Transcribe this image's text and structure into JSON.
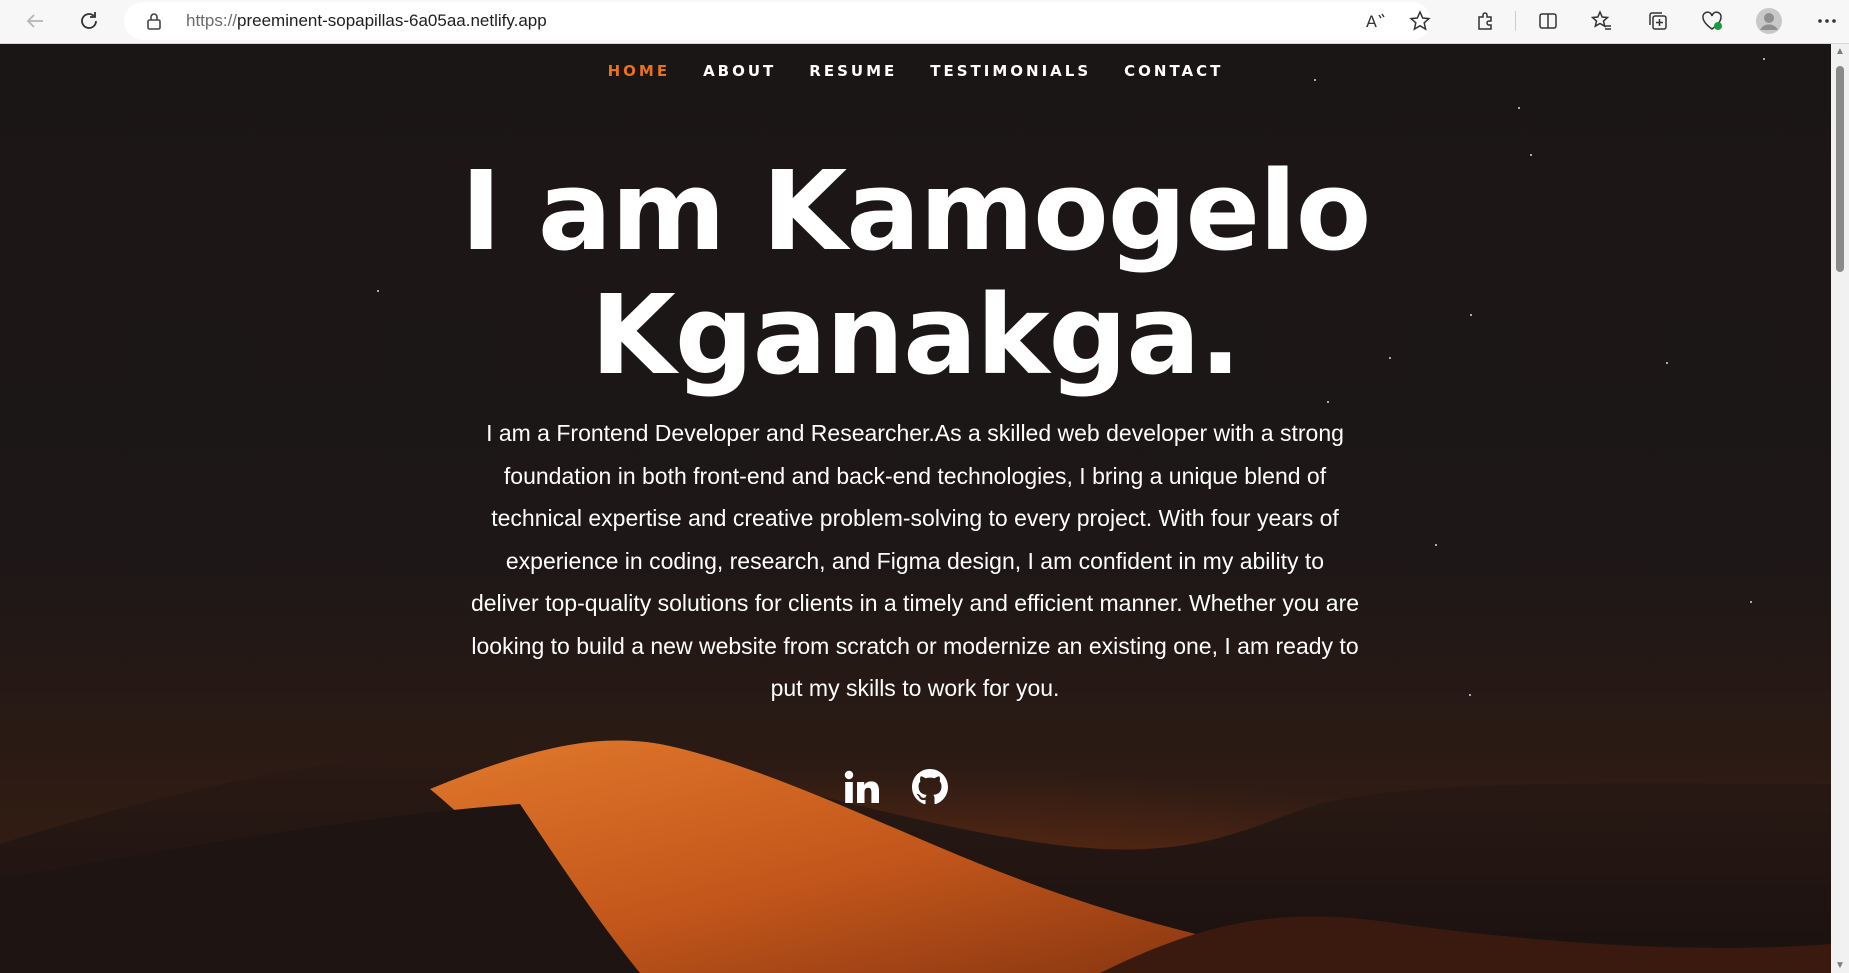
{
  "browser": {
    "url_scheme": "https://",
    "url_host": "preeminent-sopapillas-6a05aa.netlify.app"
  },
  "nav": {
    "items": [
      {
        "label": "HOME",
        "active": true
      },
      {
        "label": "ABOUT"
      },
      {
        "label": "RESUME"
      },
      {
        "label": "TESTIMONIALS"
      },
      {
        "label": "CONTACT"
      }
    ]
  },
  "hero": {
    "title_line1": "I am Kamogelo",
    "title_line2": "Kganakga.",
    "bio": "I am a Frontend Developer and Researcher.As a skilled web developer with a strong foundation in both front-end and back-end technologies, I bring a unique blend of technical expertise and creative problem-solving to every project. With four years of experience in coding, research, and Figma design, I am confident in my ability to deliver top-quality solutions for clients in a timely and efficient manner. Whether you are looking to build a new website from scratch or modernize an existing one, I am ready to put my skills to work for you."
  },
  "social": {
    "icons": [
      "linkedin-icon",
      "github-icon"
    ]
  },
  "colors": {
    "accent": "#e8711a",
    "background": "#1c1717",
    "dune": "#c0571c"
  }
}
